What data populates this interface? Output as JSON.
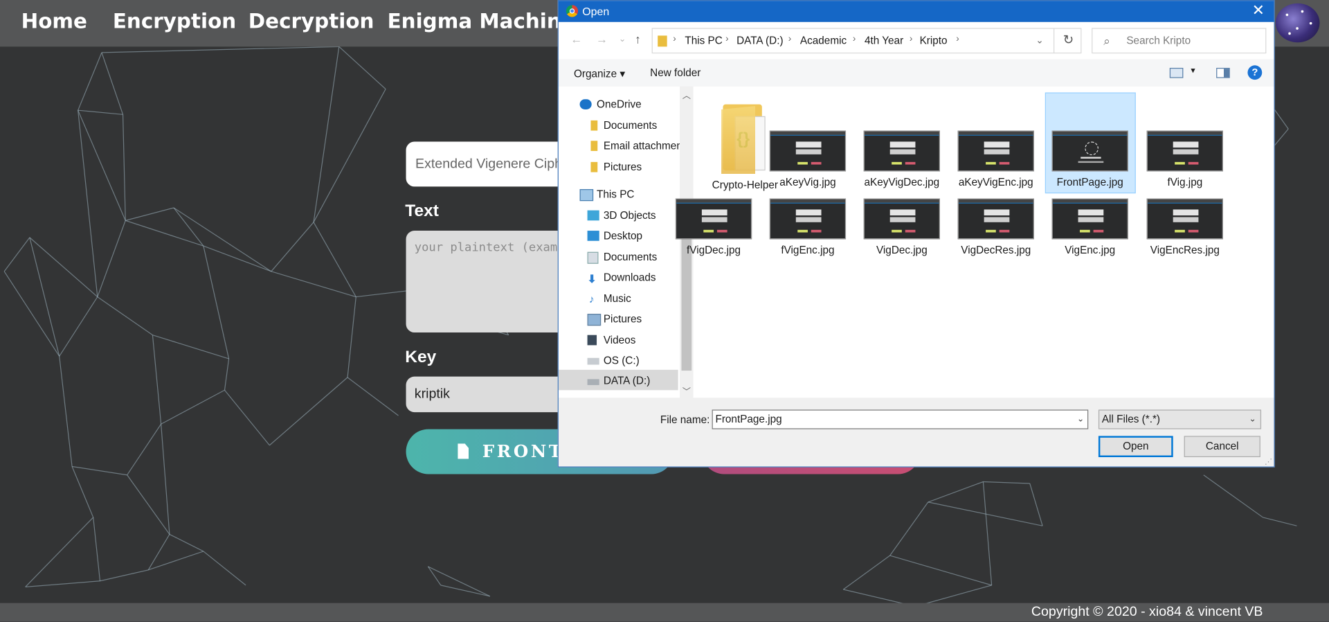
{
  "nav": {
    "home": "Home",
    "encryption": "Encryption",
    "decryption": "Decryption",
    "enigma": "Enigma Machine"
  },
  "form": {
    "cipher_selected": "Extended Vigenere Cipher",
    "text_label": "Text",
    "text_placeholder": "your plaintext (example",
    "key_label": "Key",
    "key_value": "kriptik",
    "file_button": "FRONTP"
  },
  "footer": {
    "copyright": "Copyright © 2020 - xio84 & vincent VB"
  },
  "dialog": {
    "title": "Open",
    "breadcrumb": [
      "This PC",
      "DATA (D:)",
      "Academic",
      "4th Year",
      "Kripto"
    ],
    "search_placeholder": "Search Kripto",
    "toolbar": {
      "organize": "Organize",
      "new_folder": "New folder"
    },
    "nav_pane": {
      "onedrive": "OneDrive",
      "onedrive_items": [
        "Documents",
        "Email attachmen",
        "Pictures"
      ],
      "this_pc": "This PC",
      "this_pc_items": [
        "3D Objects",
        "Desktop",
        "Documents",
        "Downloads",
        "Music",
        "Pictures",
        "Videos",
        "OS (C:)",
        "DATA (D:)"
      ],
      "selected": "DATA (D:)"
    },
    "files": [
      "Crypto-Helper",
      "aKeyVig.jpg",
      "aKeyVigDec.jpg",
      "aKeyVigEnc.jpg",
      "FrontPage.jpg",
      "fVig.jpg",
      "fVigDec.jpg",
      "fVigEnc.jpg",
      "VigDec.jpg",
      "VigDecRes.jpg",
      "VigEnc.jpg",
      "VigEncRes.jpg"
    ],
    "selected_file": "FrontPage.jpg",
    "file_name_label": "File name:",
    "file_name_value": "FrontPage.jpg",
    "file_type": "All Files (*.*)",
    "open_button": "Open",
    "cancel_button": "Cancel"
  },
  "colors": {
    "background": "#333435",
    "nav_bar": "#555657",
    "dialog_title": "#1567c6",
    "selection": "#cce8ff",
    "accent_button": "#0078d7"
  }
}
